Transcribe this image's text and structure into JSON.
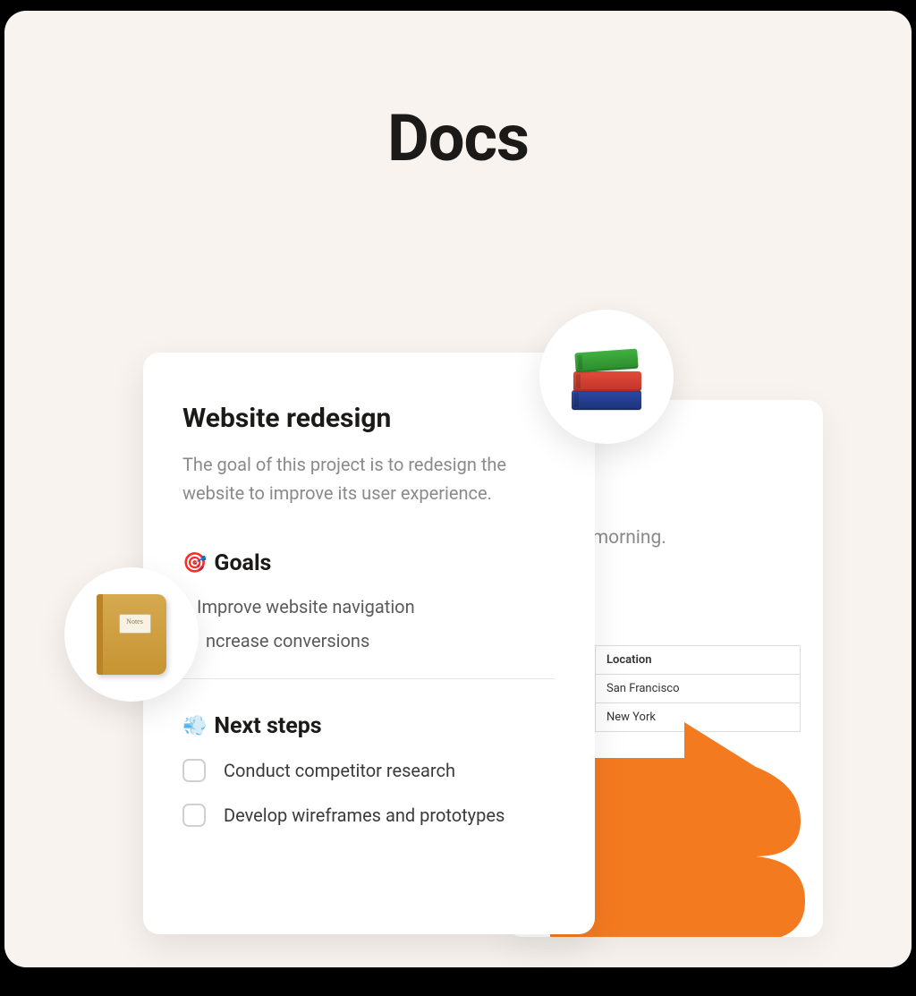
{
  "heading": "Docs",
  "front_card": {
    "title": "Website redesign",
    "description": "The goal of this project is to redesign the website to improve its user experience.",
    "goals": {
      "icon": "🎯",
      "label": "Goals",
      "items": [
        "Improve website navigation",
        "ncrease conversions"
      ]
    },
    "next_steps": {
      "icon": "💨",
      "label": "Next steps",
      "items": [
        "Conduct competitor research",
        "Develop wireframes and prototypes"
      ]
    }
  },
  "back_card": {
    "snippet": "in the morning.",
    "table": {
      "header": "Location",
      "rows": [
        "San Francisco",
        "New York"
      ]
    }
  },
  "badges": {
    "books_icon": "books-stack",
    "notebook_icon": "notebook",
    "notebook_label": "Notes"
  },
  "colors": {
    "accent_orange": "#f47a20",
    "canvas_bg": "#f8f3ef"
  }
}
